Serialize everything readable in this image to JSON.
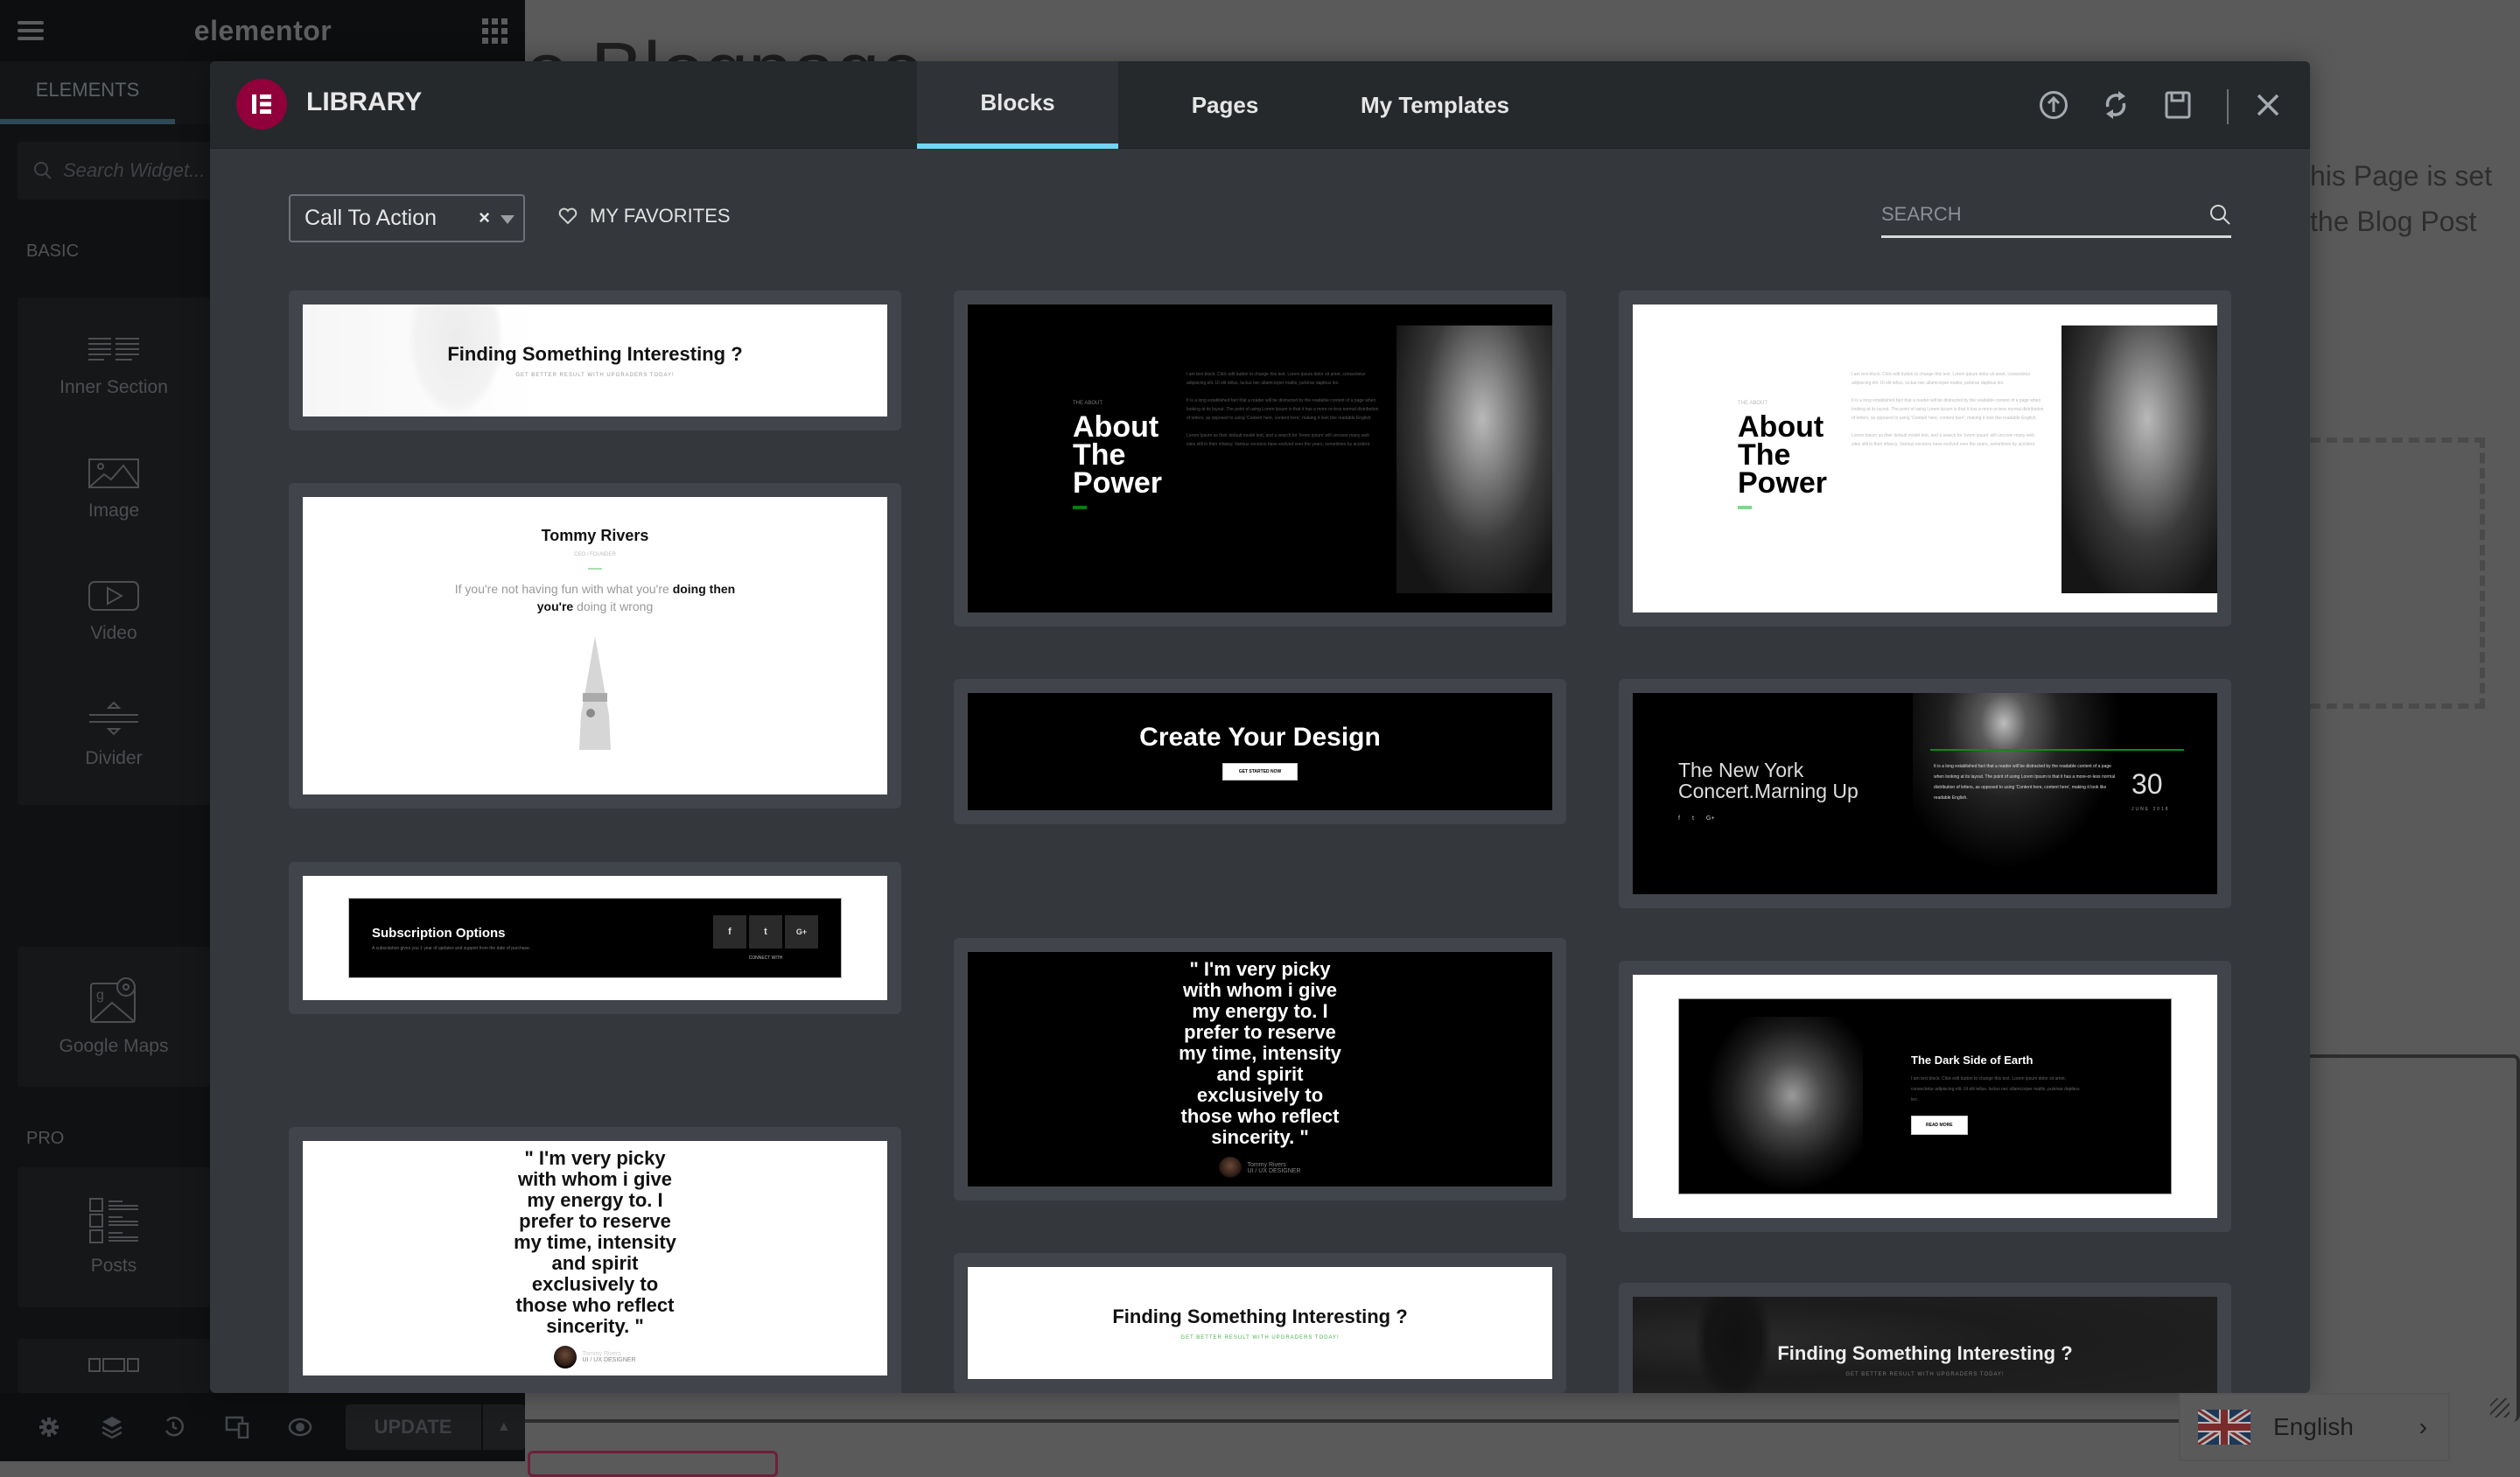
{
  "app": {
    "name": "elementor"
  },
  "background_page": {
    "title_fragment": "e Blogpage",
    "paragraph_lines": [
      "his Page is set",
      "the Blog Post"
    ]
  },
  "panel": {
    "tab_elements": "ELEMENTS",
    "search_placeholder": "Search Widget...",
    "categories": {
      "basic": "BASIC",
      "pro": "PRO"
    },
    "widgets": [
      {
        "label": "Inner Section",
        "icon": "inner-section-icon"
      },
      {
        "label": "Image",
        "icon": "image-icon"
      },
      {
        "label": "Video",
        "icon": "video-icon"
      },
      {
        "label": "Divider",
        "icon": "divider-icon"
      },
      {
        "label": "Google Maps",
        "icon": "google-maps-icon"
      },
      {
        "label": "Posts",
        "icon": "posts-icon"
      }
    ],
    "footer": {
      "icons": [
        "settings-icon",
        "navigator-icon",
        "history-icon",
        "responsive-icon",
        "preview-icon"
      ],
      "update_label": "UPDATE"
    }
  },
  "library": {
    "title": "LIBRARY",
    "tabs": [
      {
        "label": "Blocks",
        "active": true
      },
      {
        "label": "Pages",
        "active": false
      },
      {
        "label": "My Templates",
        "active": false
      }
    ],
    "header_icons": [
      "import-icon",
      "sync-icon",
      "save-icon",
      "close-icon"
    ],
    "filter": {
      "selected": "Call To Action",
      "clear": "×"
    },
    "favorites_label": "MY FAVORITES",
    "search_placeholder": "SEARCH",
    "accent_color": "#71d7f7",
    "brand_color": "#92003b",
    "templates": {
      "col1": [
        {
          "type": "cta-light",
          "title": "Finding Something Interesting ?",
          "subtitle": "GET BETTER RESULT WITH UPGRADERS TODAY!"
        },
        {
          "type": "testimonial-light",
          "name": "Tommy Rivers",
          "role": "CEO / FOUNDER",
          "quote_normal_1": "If you're not having fun with what you're ",
          "quote_bold_1": "doing then",
          "quote_bold_2": "you're",
          "quote_normal_2": " doing it wrong"
        },
        {
          "type": "subscription",
          "title": "Subscription Options",
          "text": "A subscription gives you 1 year of updates and support from the date of purchase.",
          "connect": "CONNECT WITH",
          "social": [
            "f",
            "t",
            "G+"
          ]
        },
        {
          "type": "quote-light",
          "quote": "\" I'm very picky with whom i give my energy to. I prefer to reserve my time, intensity and spirit exclusively to those who reflect sincerity. \"",
          "author": "Tommy Rivers",
          "role": "UI / UX DESIGNER"
        }
      ],
      "col2": [
        {
          "type": "about-dark",
          "eyebrow": "THE ABOUT",
          "title_lines": [
            "About",
            "The",
            "Power"
          ],
          "paragraphs": [
            "I am text block. Click edit button to change this text. Lorem ipsum dolor sit amet, consectetur adipiscing elit. Ut elit tellus, luctus nec ullamcorper mattis, pulvinar dapibus leo.",
            "It is a long established fact that a reader will be distracted by the readable content of a page when looking at its layout. The point of using Lorem Ipsum is that it has a more-or-less normal distribution of letters, as opposed to using 'Content here, content here', making it look like readable English.",
            "Lorem Ipsum as their default model text, and a search for 'lorem ipsum' will uncover many web sites still in their infancy. Various versions have evolved over the years, sometimes by accident."
          ]
        },
        {
          "type": "cta-dark",
          "title": "Create Your Design",
          "button": "GET STARTED NOW"
        },
        {
          "type": "quote-dark",
          "quote": "\" I'm very picky with whom i give my energy to. I prefer to reserve my time, intensity and spirit exclusively to those who reflect sincerity. \"",
          "author": "Tommy Rivers",
          "role": "UI / UX DESIGNER"
        },
        {
          "type": "cta-white-green",
          "title": "Finding Something Interesting ?",
          "subtitle": "GET BETTER RESULT WITH UPGRADERS TODAY!"
        }
      ],
      "col3": [
        {
          "type": "about-light",
          "eyebrow": "THE ABOUT",
          "title_lines": [
            "About",
            "The",
            "Power"
          ],
          "paragraphs": [
            "I am text block. Click edit button to change this text. Lorem ipsum dolor sit amet, consectetur adipiscing elit. Ut elit tellus, luctus nec ullamcorper mattis, pulvinar dapibus leo.",
            "It is a long established fact that a reader will be distracted by the readable content of a page when looking at its layout. The point of using Lorem Ipsum is that it has a more-or-less normal distribution of letters, as opposed to using 'Content here, content here', making it look like readable English.",
            "Lorem Ipsum as their default model text, and a search for 'lorem ipsum' will uncover many web sites still in their infancy. Various versions have evolved over the years, sometimes by accident."
          ]
        },
        {
          "type": "event-dark",
          "title_lines": [
            "The New York",
            "Concert.Marning Up"
          ],
          "text": "It is a long established fact that a reader will be distracted by the readable content of a page when looking at its layout. The point of using Lorem Ipsum is that it has a more-or-less normal distribution of letters, as opposed to using 'Content here, content here', making it look like readable English.",
          "day": "30",
          "month": "JUNE 2018",
          "social": [
            "f",
            "t",
            "G+"
          ]
        },
        {
          "type": "feature-dark",
          "title": "The Dark Side of Earth",
          "text": "I am text block. Click edit button to change this text. Lorem ipsum dolor sit amet, consectetur adipiscing elit. Ut elit tellus, luctus nec ullamcorper mattis, pulvinar dapibus leo.",
          "button": "READ MORE"
        },
        {
          "type": "cta-dark-photo",
          "title": "Finding Something Interesting ?",
          "subtitle": "GET BETTER RESULT WITH UPGRADERS TODAY!"
        }
      ]
    }
  },
  "language": {
    "label": "English",
    "flag": "uk-flag-icon"
  }
}
